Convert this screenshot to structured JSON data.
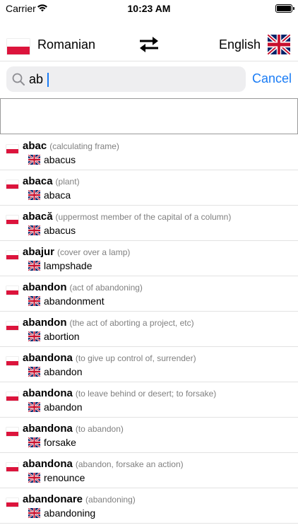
{
  "status_bar": {
    "carrier": "Carrier",
    "time": "10:23 AM"
  },
  "language_bar": {
    "source_language": "Romanian",
    "target_language": "English"
  },
  "search": {
    "value": "ab",
    "cancel_label": "Cancel"
  },
  "colors": {
    "accent": "#1a7cf5",
    "ro_red": "#dc143c",
    "uk_blue": "#012169",
    "uk_red": "#c8102e"
  },
  "results": [
    {
      "word": "abac",
      "note": "(calculating frame)",
      "translation": "abacus"
    },
    {
      "word": "abaca",
      "note": "(plant)",
      "translation": "abaca"
    },
    {
      "word": "abacă",
      "note": "(uppermost member of the capital of a column)",
      "translation": "abacus"
    },
    {
      "word": "abajur",
      "note": "(cover over a lamp)",
      "translation": "lampshade"
    },
    {
      "word": "abandon",
      "note": "(act of abandoning)",
      "translation": "abandonment"
    },
    {
      "word": "abandon",
      "note": "(the act of aborting a project, etc)",
      "translation": "abortion"
    },
    {
      "word": "abandona",
      "note": "(to give up control of, surrender)",
      "translation": "abandon"
    },
    {
      "word": "abandona",
      "note": "(to leave behind or desert; to forsake)",
      "translation": "abandon"
    },
    {
      "word": "abandona",
      "note": "(to abandon)",
      "translation": "forsake"
    },
    {
      "word": "abandona",
      "note": "(abandon, forsake an action)",
      "translation": "renounce"
    },
    {
      "word": "abandonare",
      "note": "(abandoning)",
      "translation": "abandoning"
    }
  ]
}
